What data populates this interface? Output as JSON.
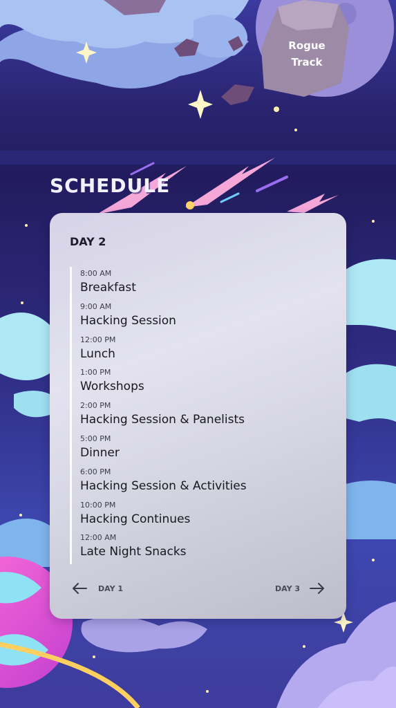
{
  "colors": {
    "sky_dark": "#2a2570",
    "sky_mid": "#3b3ea8",
    "card_bg": "#dcdbe8",
    "accent": "#ffffff"
  },
  "header": {
    "title": "SCHEDULE"
  },
  "rogue_track": {
    "line1": "Rogue",
    "line2": "Track"
  },
  "schedule": {
    "day_title": "DAY 2",
    "items": [
      {
        "time": "8:00 AM",
        "event": "Breakfast"
      },
      {
        "time": "9:00 AM",
        "event": "Hacking Session"
      },
      {
        "time": "12:00 PM",
        "event": "Lunch"
      },
      {
        "time": "1:00 PM",
        "event": "Workshops"
      },
      {
        "time": "2:00 PM",
        "event": "Hacking Session & Panelists"
      },
      {
        "time": "5:00 PM",
        "event": "Dinner"
      },
      {
        "time": "6:00 PM",
        "event": "Hacking Session & Activities"
      },
      {
        "time": "10:00 PM",
        "event": "Hacking Continues"
      },
      {
        "time": "12:00 AM",
        "event": "Late Night Snacks"
      }
    ],
    "prev_label": "DAY 1",
    "next_label": "DAY 3",
    "prev_icon": "arrow-left-icon",
    "next_icon": "arrow-right-icon"
  }
}
